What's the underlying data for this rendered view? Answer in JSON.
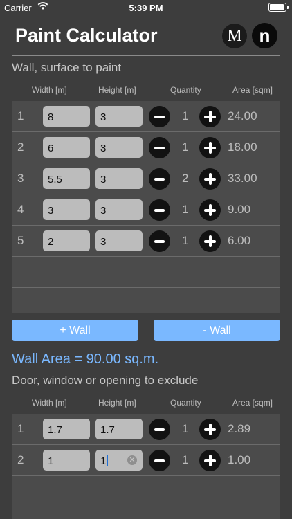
{
  "status": {
    "carrier": "Carrier",
    "time": "5:39 PM"
  },
  "app": {
    "title": "Paint Calculator",
    "logo_m": "M",
    "logo_n": "n"
  },
  "walls": {
    "section_label": "Wall, surface to paint",
    "headers": {
      "width": "Width [m]",
      "height": "Height [m]",
      "quantity": "Quantity",
      "area": "Area [sqm]"
    },
    "rows": [
      {
        "index": "1",
        "width": "8",
        "height": "3",
        "quantity": "1",
        "area": "24.00"
      },
      {
        "index": "2",
        "width": "6",
        "height": "3",
        "quantity": "1",
        "area": "18.00"
      },
      {
        "index": "3",
        "width": "5.5",
        "height": "3",
        "quantity": "2",
        "area": "33.00"
      },
      {
        "index": "4",
        "width": "3",
        "height": "3",
        "quantity": "1",
        "area": "9.00"
      },
      {
        "index": "5",
        "width": "2",
        "height": "3",
        "quantity": "1",
        "area": "6.00"
      }
    ],
    "add_label": "+ Wall",
    "remove_label": "- Wall",
    "total": "Wall Area = 90.00 sq.m."
  },
  "openings": {
    "section_label": "Door, window or opening to exclude",
    "headers": {
      "width": "Width [m]",
      "height": "Height [m]",
      "quantity": "Quantity",
      "area": "Area [sqm]"
    },
    "rows": [
      {
        "index": "1",
        "width": "1.7",
        "height": "1.7",
        "quantity": "1",
        "area": "2.89"
      },
      {
        "index": "2",
        "width": "1",
        "height": "1",
        "quantity": "1",
        "area": "1.00"
      }
    ]
  }
}
